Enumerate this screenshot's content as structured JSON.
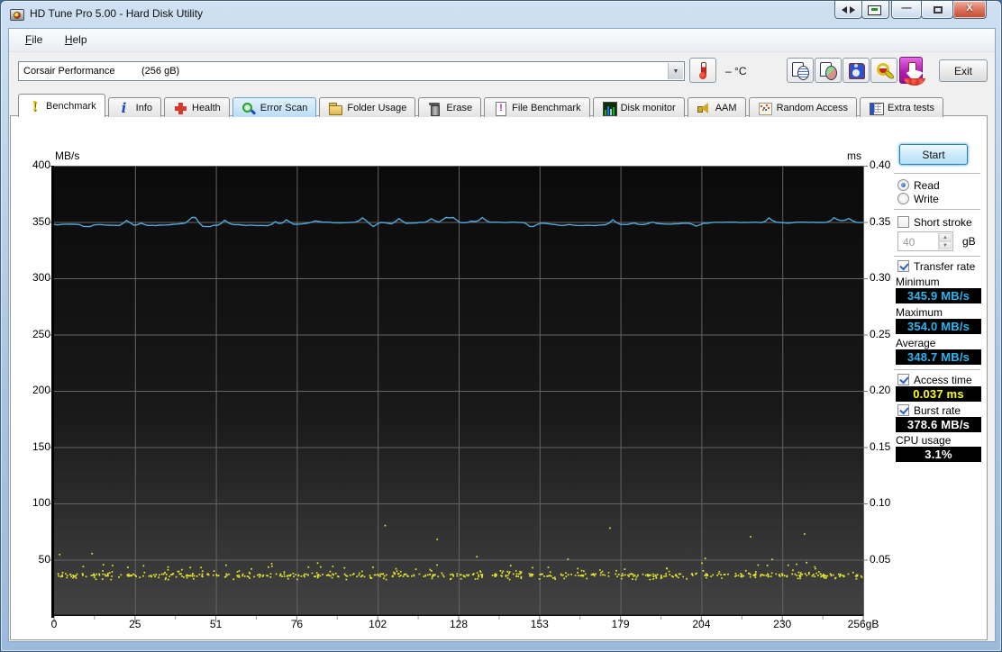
{
  "window": {
    "title": "HD Tune Pro 5.00 - Hard Disk Utility",
    "controls": [
      {
        "name": "compare",
        "icon": "arrows-left-right-icon"
      },
      {
        "name": "window-export",
        "icon": "window-export-icon"
      },
      {
        "name": "minimize",
        "glyph": "—"
      },
      {
        "name": "maximize",
        "glyph": ""
      },
      {
        "name": "close",
        "glyph": "X"
      }
    ]
  },
  "menu": {
    "items": [
      {
        "label": "File"
      },
      {
        "label": "Help"
      }
    ]
  },
  "toolbar": {
    "drive_selector": {
      "name": "Corsair Performance",
      "capacity": "(256 gB)"
    },
    "temperature": {
      "value": "–",
      "unit": "°C"
    },
    "buttons": [
      {
        "name": "copy-report",
        "icon": "copy-text-icon"
      },
      {
        "name": "copy-screenshot",
        "icon": "copy-image-icon"
      },
      {
        "name": "save",
        "icon": "save-icon"
      },
      {
        "name": "options",
        "icon": "options-icon"
      },
      {
        "name": "download",
        "icon": "download-arrow-icon"
      }
    ],
    "exit_label": "Exit"
  },
  "tabs": {
    "active": "Benchmark",
    "highlighted": "Error Scan",
    "items": [
      {
        "label": "Benchmark",
        "icon": "benchmark"
      },
      {
        "label": "Info",
        "icon": "info"
      },
      {
        "label": "Health",
        "icon": "health"
      },
      {
        "label": "Error Scan",
        "icon": "error-scan"
      },
      {
        "label": "Folder Usage",
        "icon": "folder-usage"
      },
      {
        "label": "Erase",
        "icon": "erase"
      },
      {
        "label": "File Benchmark",
        "icon": "file-benchmark"
      },
      {
        "label": "Disk monitor",
        "icon": "disk-monitor"
      },
      {
        "label": "AAM",
        "icon": "aam"
      },
      {
        "label": "Random Access",
        "icon": "random-access"
      },
      {
        "label": "Extra tests",
        "icon": "extra-tests"
      }
    ]
  },
  "benchmark_panel": {
    "start_label": "Start",
    "mode_options": [
      {
        "label": "Read",
        "selected": true
      },
      {
        "label": "Write",
        "selected": false
      }
    ],
    "short_stroke": {
      "label": "Short stroke",
      "checked": false,
      "value": "40",
      "unit": "gB"
    },
    "transfer_rate": {
      "label": "Transfer rate",
      "checked": true,
      "minimum_label": "Minimum",
      "minimum_value": "345.9 MB/s",
      "maximum_label": "Maximum",
      "maximum_value": "354.0 MB/s",
      "average_label": "Average",
      "average_value": "348.7 MB/s"
    },
    "access_time": {
      "label": "Access time",
      "checked": true,
      "value": "0.037 ms"
    },
    "burst_rate": {
      "label": "Burst rate",
      "checked": true,
      "value": "378.6 MB/s"
    },
    "cpu_usage": {
      "label": "CPU usage",
      "value": "3.1%"
    },
    "value_colors": {
      "transfer": "#29b6f0",
      "access": "#ffff00",
      "plain": "#ffffff"
    }
  },
  "chart_data": {
    "type": "line+scatter",
    "x_axis": {
      "unit": "gB",
      "range": [
        0,
        256
      ],
      "tick_labels": [
        "0",
        "25",
        "51",
        "76",
        "102",
        "128",
        "153",
        "179",
        "204",
        "230",
        "256gB"
      ]
    },
    "y_left": {
      "label": "MB/s",
      "range": [
        0,
        400
      ],
      "ticks": [
        400,
        350,
        300,
        250,
        200,
        150,
        100,
        50
      ]
    },
    "y_right": {
      "label": "ms",
      "range": [
        0,
        0.4
      ],
      "ticks": [
        "0.40",
        "0.35",
        "0.30",
        "0.25",
        "0.20",
        "0.15",
        "0.10",
        "0.05"
      ]
    },
    "grid": true,
    "grid_color": "#646464",
    "bg_top": "#0a0a0a",
    "bg_bottom": "#434343",
    "series": [
      {
        "name": "transfer-rate",
        "type": "line",
        "color": "#4fa8dc",
        "unit": "MB/s",
        "min": 345.9,
        "max": 354.0,
        "average": 348.7,
        "baseline": 348.3,
        "points": 224,
        "spikes": 30,
        "seed": 7
      },
      {
        "name": "access-time",
        "type": "scatter",
        "color": "#e6e632",
        "unit": "ms",
        "typical": 0.037,
        "band": [
          0.033,
          0.041
        ],
        "outlier_max": 0.085,
        "count": 640,
        "seed": 11
      }
    ]
  }
}
